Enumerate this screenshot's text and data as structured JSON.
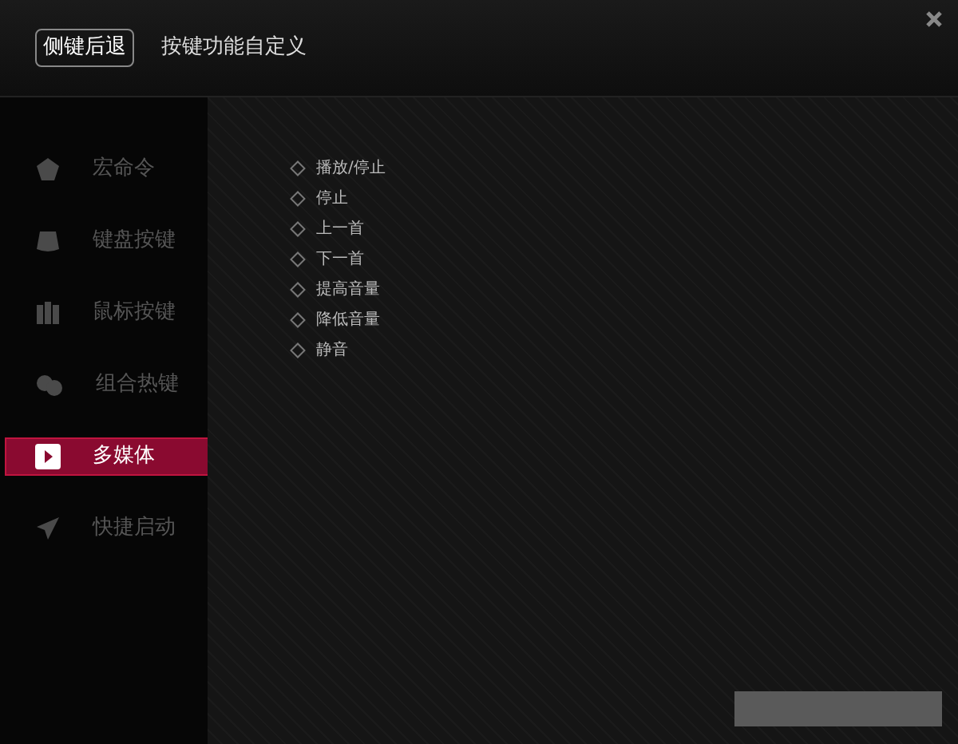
{
  "header": {
    "tabs": [
      {
        "label": "侧键后退",
        "selected": true
      },
      {
        "label": "按键功能自定义",
        "selected": false
      }
    ]
  },
  "sidebar": {
    "items": [
      {
        "label": "宏命令",
        "selected": false
      },
      {
        "label": "键盘按键",
        "selected": false
      },
      {
        "label": "鼠标按键",
        "selected": false
      },
      {
        "label": "组合热键",
        "selected": false
      },
      {
        "label": "多媒体",
        "selected": true
      },
      {
        "label": "快捷启动",
        "selected": false
      }
    ]
  },
  "options": [
    {
      "label": "播放/停止",
      "selected": false
    },
    {
      "label": "停止",
      "selected": false
    },
    {
      "label": "上一首",
      "selected": false
    },
    {
      "label": "下一首",
      "selected": false
    },
    {
      "label": "提高音量",
      "selected": false
    },
    {
      "label": "降低音量",
      "selected": false
    },
    {
      "label": "静音",
      "selected": false
    }
  ]
}
